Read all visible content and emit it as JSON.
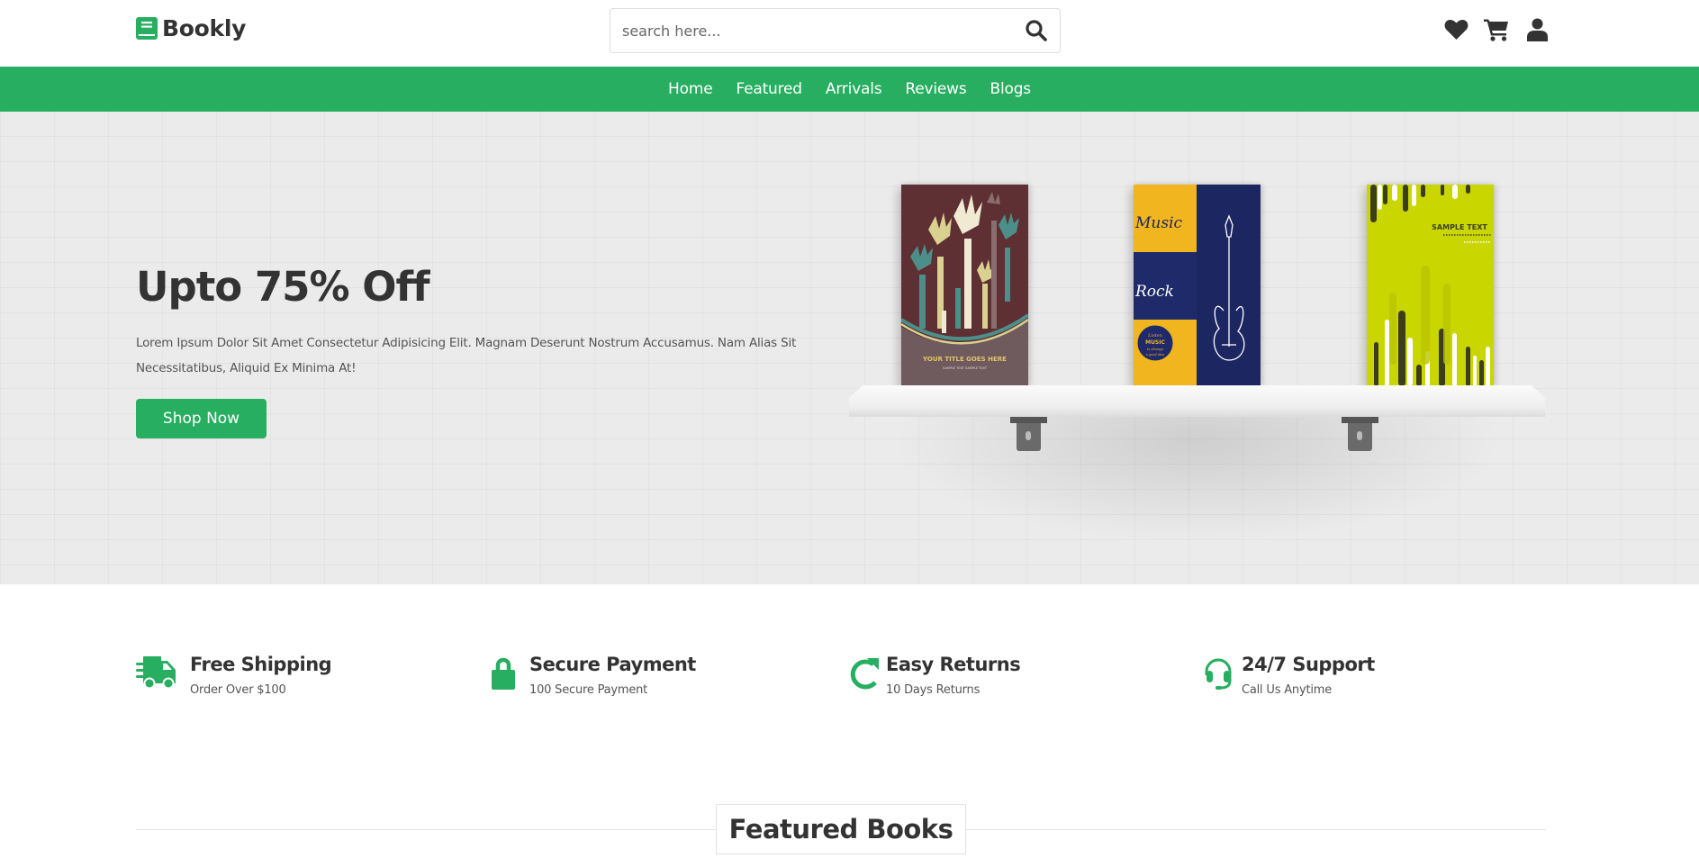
{
  "header": {
    "logo_text": "Bookly",
    "logo_icon": "book-icon",
    "search": {
      "placeholder": "search here...",
      "value": "",
      "icon": "search-icon"
    },
    "icons": [
      "heart-icon",
      "shopping-cart-icon",
      "user-icon"
    ]
  },
  "nav": {
    "items": [
      {
        "label": "Home"
      },
      {
        "label": "Featured"
      },
      {
        "label": "Arrivals"
      },
      {
        "label": "Reviews"
      },
      {
        "label": "Blogs"
      }
    ]
  },
  "hero": {
    "title": "Upto 75% Off",
    "text": "Lorem Ipsum Dolor Sit Amet Consectetur Adipisicing Elit. Magnam Deserunt Nostrum Accusamus. Nam Alias Sit Necessitatibus, Aliquid Ex Minima At!",
    "button_label": "Shop Now",
    "books": [
      {
        "cover_title": "YOUR TITLE GOES HERE",
        "cover_subtitle": "SAMPLE TEXT SAMPLE TEXT"
      },
      {
        "cover_words": [
          "Music",
          "Rock",
          "Listen",
          "MUSIC",
          "is always",
          "a good idea"
        ]
      },
      {
        "cover_title": "SAMPLE TEXT"
      }
    ]
  },
  "features": [
    {
      "icon": "shipping-truck-icon",
      "title": "Free Shipping",
      "subtitle": "Order Over $100"
    },
    {
      "icon": "lock-icon",
      "title": "Secure Payment",
      "subtitle": "100 Secure Payment"
    },
    {
      "icon": "redo-arrow-icon",
      "title": "Easy Returns",
      "subtitle": "10 Days Returns"
    },
    {
      "icon": "headset-icon",
      "title": "24/7 Support",
      "subtitle": "Call Us Anytime"
    }
  ],
  "featured_section": {
    "heading": "Featured Books"
  },
  "colors": {
    "accent": "#27ae60",
    "text": "#333333",
    "hero_bg": "#ebebeb"
  }
}
